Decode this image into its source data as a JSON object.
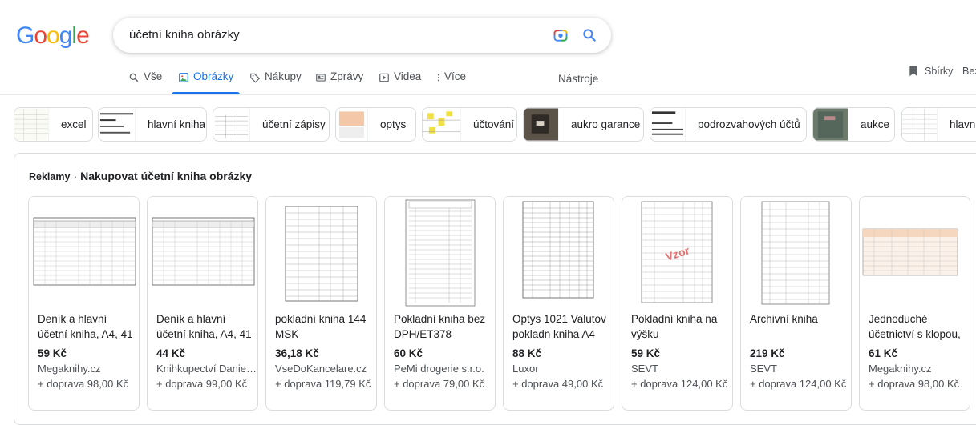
{
  "logo": {
    "text": "Google",
    "letters": [
      "G",
      "o",
      "o",
      "g",
      "l",
      "e"
    ],
    "colors": [
      "#4285F4",
      "#EA4335",
      "#FBBC05",
      "#4285F4",
      "#34A853",
      "#EA4335"
    ]
  },
  "search": {
    "query": "účetní kniha obrázky",
    "lens_icon": "camera-lens-icon",
    "search_icon": "magnifier-icon"
  },
  "tabs": [
    {
      "label": "Vše",
      "icon": "search-icon",
      "active": false
    },
    {
      "label": "Obrázky",
      "icon": "image-icon",
      "active": true
    },
    {
      "label": "Nákupy",
      "icon": "tag-icon",
      "active": false
    },
    {
      "label": "Zprávy",
      "icon": "news-icon",
      "active": false
    },
    {
      "label": "Videa",
      "icon": "play-icon",
      "active": false
    },
    {
      "label": "Více",
      "icon": "more-vert-icon",
      "active": false
    }
  ],
  "tools_label": "Nástroje",
  "collections_label": "Sbírky",
  "bez_label": "Bez",
  "chips": [
    {
      "label": "excel"
    },
    {
      "label": "hlavní kniha"
    },
    {
      "label": "účetní zápisy"
    },
    {
      "label": "optys"
    },
    {
      "label": "účtování"
    },
    {
      "label": "aukro garance"
    },
    {
      "label": "podrozvahových účtů"
    },
    {
      "label": "aukce"
    },
    {
      "label": "hlavní u"
    }
  ],
  "ads": {
    "label": "Reklamy",
    "separator": "·",
    "title": "Nakupovat účetní kniha obrázky",
    "products": [
      {
        "title": "Deník a hlavní účetní kniha, A4, 41",
        "price": "59 Kč",
        "seller": "Megaknihy.cz",
        "shipping": "+ doprava 98,00 Kč"
      },
      {
        "title": "Deník a hlavní účetní kniha, A4, 41",
        "price": "44 Kč",
        "seller": "Knihkupectví Danie…",
        "shipping": "+ doprava 99,00 Kč"
      },
      {
        "title": "pokladní kniha 144 MSK",
        "price": "36,18 Kč",
        "seller": "VseDoKancelare.cz",
        "shipping": "+ doprava 119,79 Kč"
      },
      {
        "title": "Pokladní kniha bez DPH/ET378",
        "price": "60 Kč",
        "seller": "PeMi drogerie s.r.o.",
        "shipping": "+ doprava 79,00 Kč"
      },
      {
        "title": "Optys 1021 Valutov pokladn kniha A4",
        "price": "88 Kč",
        "seller": "Luxor",
        "shipping": "+ doprava 49,00 Kč"
      },
      {
        "title": "Pokladní kniha na výšku",
        "price": "59 Kč",
        "seller": "SEVT",
        "shipping": "+ doprava 124,00 Kč",
        "watermark": "Vzor"
      },
      {
        "title": "Archivní kniha",
        "price": "219 Kč",
        "seller": "SEVT",
        "shipping": "+ doprava 124,00 Kč"
      },
      {
        "title": "Jednoduché účetnictví s klopou,",
        "price": "61 Kč",
        "seller": "Megaknihy.cz",
        "shipping": "+ doprava 98,00 Kč"
      }
    ]
  },
  "colors": {
    "accent": "#1a73e8",
    "text": "#202124",
    "muted": "#4d5156",
    "border": "#dadce0"
  }
}
